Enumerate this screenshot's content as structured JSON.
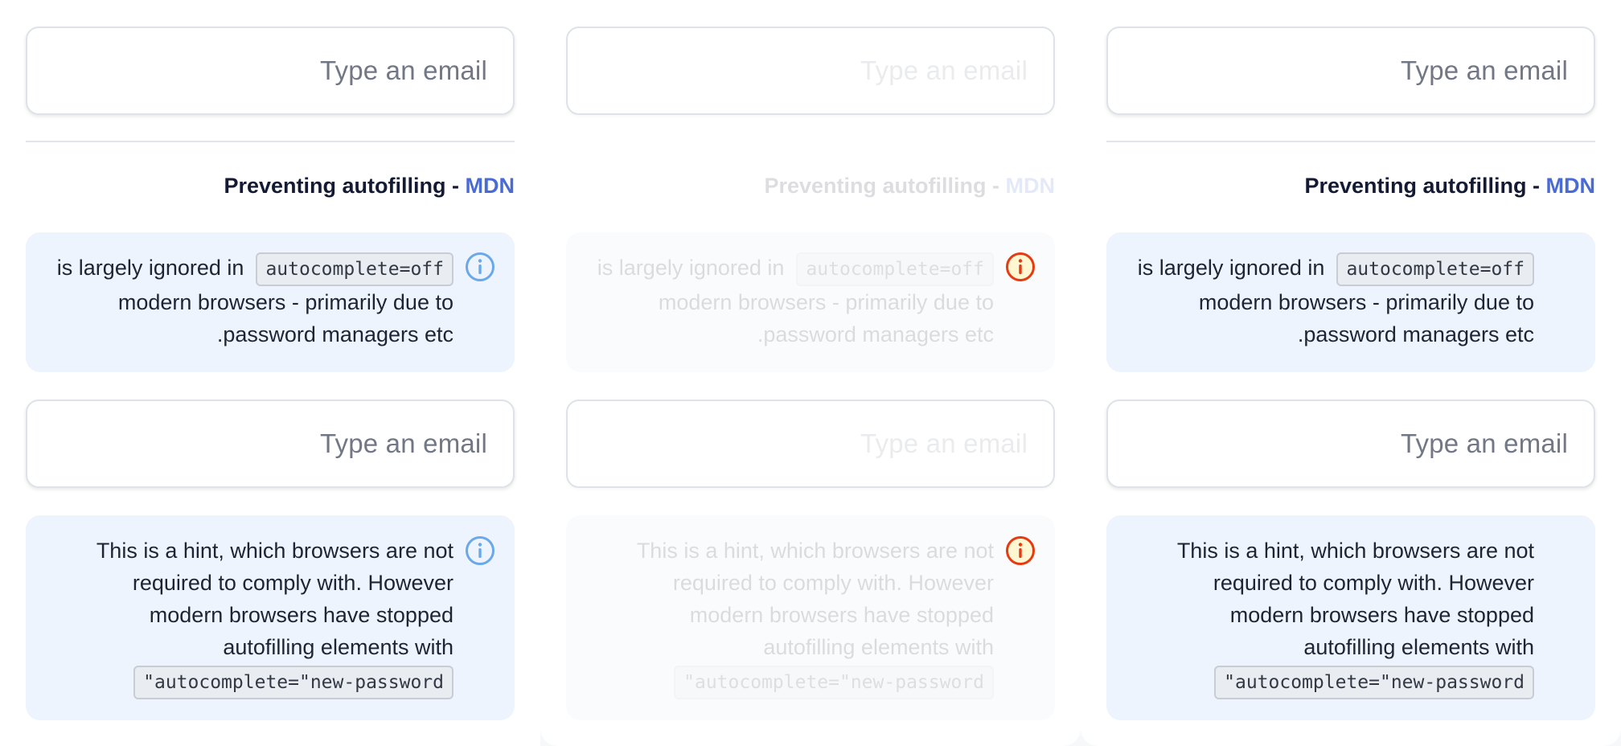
{
  "email_placeholder": "Type an email",
  "heading": {
    "text": "Preventing autofilling",
    "separator": "-",
    "link": "MDN"
  },
  "hint1": {
    "line1_prefix": "is largely ignored in",
    "code": "autocomplete=off",
    "line2": "modern browsers - primarily due to",
    "line3": ".password managers etc"
  },
  "hint2": {
    "line1": "This is a hint, which browsers are not",
    "line2": "required to comply with. However",
    "line3": "modern browsers have stopped",
    "line4": "autofilling elements with",
    "code": "\"autocomplete=\"new-password"
  },
  "icons": {
    "info": "info-circle-icon",
    "warning": "warning-circle-icon"
  },
  "colors": {
    "link": "#4a6bd3",
    "info_icon": "#6aa8ea",
    "warning_icon": "#e53a12",
    "hint_bg": "#edf4fe"
  }
}
